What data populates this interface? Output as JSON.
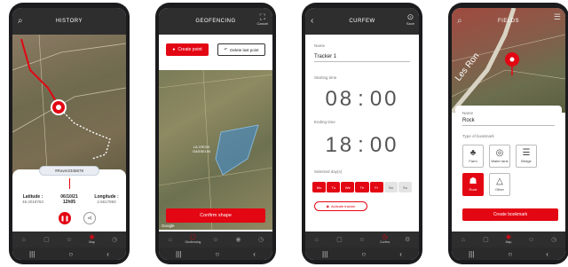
{
  "colors": {
    "accent": "#e30613",
    "bar": "#2e2e2e",
    "zone": "#4f89b6"
  },
  "tabbar": {
    "icons": [
      "home-icon",
      "grid-icon",
      "person-icon",
      "map-pin-icon",
      "clock-icon"
    ],
    "labels": [
      "",
      "",
      "Map",
      "",
      ""
    ],
    "labels_geofencing": [
      "",
      "Geofencing",
      "",
      "",
      ""
    ],
    "labels_curfew": [
      "",
      "",
      "",
      "Curfew",
      ""
    ]
  },
  "navbar": {
    "icons": [
      "menu-icon",
      "home-circle-icon",
      "back-icon"
    ]
  },
  "history": {
    "title": "HISTORY",
    "device_id": "#Rover2345678",
    "latitude_label": "Latitude :",
    "latitude_value": "45.2018763",
    "date": "06/10/21",
    "time": "12h05",
    "longitude_label": "Longitude :",
    "longitude_value": "2.6617893"
  },
  "geofencing": {
    "title": "GEOFENCING",
    "cancel_label": "Cancel",
    "create_point_label": "Create point",
    "delete_point_label": "Delete last point",
    "place_label": "LA CROIX\nGASSELIN",
    "confirm_label": "Confirm shape",
    "map_credit": "Google"
  },
  "curfew": {
    "title": "CURFEW",
    "save_label": "Save",
    "name_label": "Name",
    "name_value": "Tracker 1",
    "starting_label": "Starting time",
    "start_h": "08",
    "start_m": "00",
    "ending_label": "Ending time",
    "end_h": "18",
    "end_m": "00",
    "days_label": "Selected day(s)",
    "days": [
      {
        "label": "Mo",
        "on": true
      },
      {
        "label": "Tu",
        "on": true
      },
      {
        "label": "We",
        "on": true
      },
      {
        "label": "Th",
        "on": true
      },
      {
        "label": "Fr",
        "on": true
      },
      {
        "label": "Sa",
        "on": false
      },
      {
        "label": "Su",
        "on": false
      }
    ],
    "chip_label": "Activate tracker"
  },
  "fields": {
    "title": "FIELDS",
    "road_label": "Les Ron",
    "name_label": "Name",
    "name_value": "Rock",
    "type_label": "Type of bookmark",
    "types": [
      {
        "label": "Farm",
        "icon": "tree-icon"
      },
      {
        "label": "Water tank",
        "icon": "tank-icon"
      },
      {
        "label": "Bridge",
        "icon": "bridge-icon"
      },
      {
        "label": "Rock",
        "icon": "rock-icon",
        "selected": true
      },
      {
        "label": "Other",
        "icon": "triangle-icon"
      }
    ],
    "create_label": "Create bookmark"
  }
}
